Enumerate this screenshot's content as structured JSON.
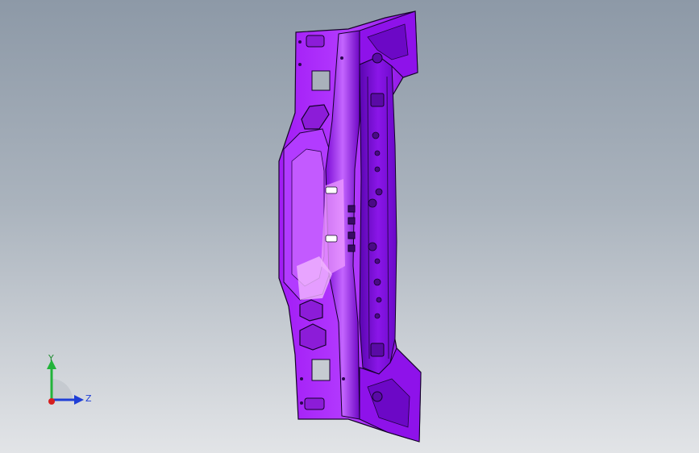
{
  "viewport": {
    "background_top": "#8d99a7",
    "background_bottom": "#e2e4e7"
  },
  "part": {
    "color": "#9d14f2",
    "shade_color": "#6a07c2",
    "highlight_color": "#e07cff",
    "edge_color": "#1a0530"
  },
  "triad": {
    "y_label": "Y",
    "z_label": "Z",
    "y_color": "#22b33a",
    "z_color": "#1f3fd6",
    "x_color": "#d61f1f"
  }
}
